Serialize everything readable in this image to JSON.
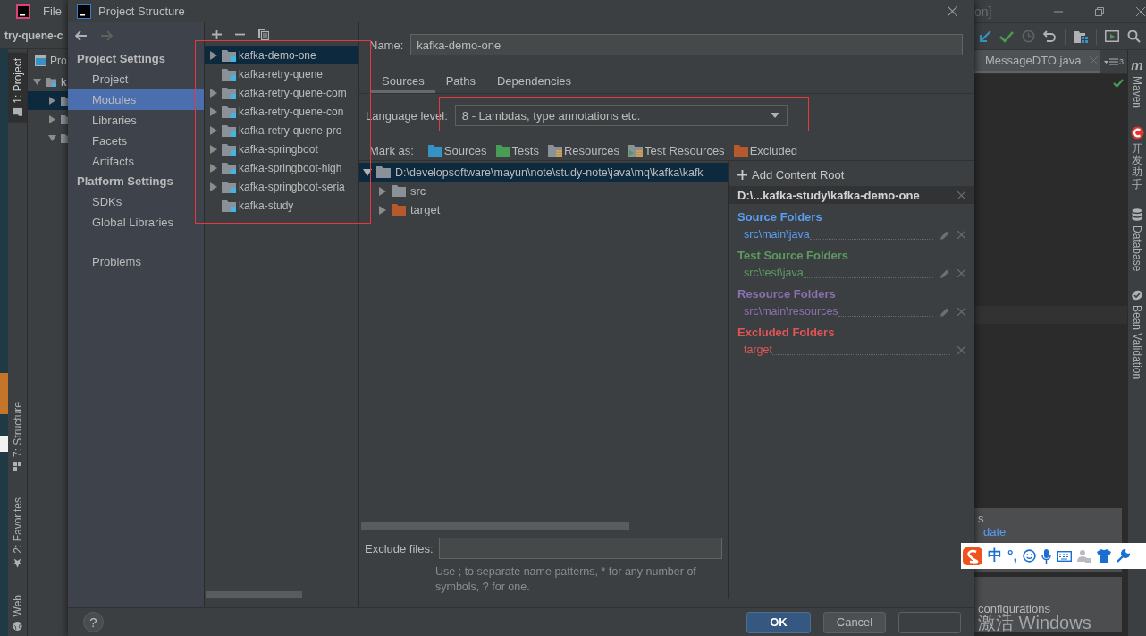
{
  "ide": {
    "menu": [
      "File"
    ],
    "project_name": "try-quene-c",
    "tool_tabs_left": [
      {
        "label": "1: Project",
        "kind": "project",
        "selected": true
      },
      {
        "label": "7: Structure",
        "kind": "structure",
        "selected": false
      },
      {
        "label": "2: Favorites",
        "kind": "favorites",
        "selected": false
      },
      {
        "label": "Web",
        "kind": "web",
        "selected": false
      }
    ],
    "project_panel": {
      "title": "Pro",
      "tree": [
        {
          "label": "k",
          "expanded": true,
          "selected": false,
          "children": [
            {
              "expanded": false,
              "selected": true
            },
            {
              "expanded": false,
              "selected": false
            },
            {
              "expanded": true,
              "selected": false
            }
          ]
        }
      ]
    },
    "window_title": "on]",
    "editor_tab": "MessageDTO.java",
    "tab_count": "3",
    "tool_tabs_right": [
      {
        "label": "Maven",
        "kind": "maven",
        "icon": "m"
      },
      {
        "label": "开发助手",
        "kind": "helper"
      },
      {
        "label": "Database",
        "kind": "database"
      },
      {
        "label": "Bean Validation",
        "kind": "bean"
      }
    ],
    "popups": [
      {
        "text": "s",
        "link": "date"
      },
      {
        "text": "configurations"
      }
    ],
    "ime": {
      "items": [
        "中",
        "°,"
      ]
    },
    "activation": "激活 Windows"
  },
  "dialog": {
    "title": "Project Structure",
    "nav": [
      {
        "heading": "Project Settings",
        "items": [
          {
            "label": "Project",
            "selected": false
          },
          {
            "label": "Modules",
            "selected": true
          },
          {
            "label": "Libraries",
            "selected": false
          },
          {
            "label": "Facets",
            "selected": false
          },
          {
            "label": "Artifacts",
            "selected": false
          }
        ]
      },
      {
        "heading": "Platform Settings",
        "items": [
          {
            "label": "SDKs",
            "selected": false
          },
          {
            "label": "Global Libraries",
            "selected": false
          }
        ]
      },
      {
        "items": [
          {
            "label": "Problems",
            "selected": false
          }
        ]
      }
    ],
    "modules": [
      {
        "name": "kafka-demo-one",
        "expandable": true,
        "selected": true
      },
      {
        "name": "kafka-retry-quene",
        "expandable": false,
        "selected": false
      },
      {
        "name": "kafka-retry-quene-com",
        "expandable": true,
        "selected": false
      },
      {
        "name": "kafka-retry-quene-con",
        "expandable": true,
        "selected": false
      },
      {
        "name": "kafka-retry-quene-pro",
        "expandable": true,
        "selected": false
      },
      {
        "name": "kafka-springboot",
        "expandable": true,
        "selected": false
      },
      {
        "name": "kafka-springboot-high",
        "expandable": true,
        "selected": false
      },
      {
        "name": "kafka-springboot-seria",
        "expandable": true,
        "selected": false
      },
      {
        "name": "kafka-study",
        "expandable": false,
        "selected": false
      }
    ],
    "name_label": "Name:",
    "name_value": "kafka-demo-one",
    "tabs": [
      {
        "label": "Sources",
        "selected": true
      },
      {
        "label": "Paths",
        "selected": false
      },
      {
        "label": "Dependencies",
        "selected": false
      }
    ],
    "language_level": {
      "label": "Language level:",
      "value": "8 - Lambdas, type annotations etc."
    },
    "mark_as": {
      "label": "Mark as:",
      "kinds": [
        {
          "label": "Sources",
          "kind": "sources"
        },
        {
          "label": "Tests",
          "kind": "tests"
        },
        {
          "label": "Resources",
          "kind": "resources"
        },
        {
          "label": "Test Resources",
          "kind": "test_resources"
        },
        {
          "label": "Excluded",
          "kind": "excluded"
        }
      ]
    },
    "content_tree": {
      "path": "D:\\developsoftware\\mayun\\note\\study-note\\java\\mq\\kafka\\kafk",
      "expanded": true,
      "selected": true,
      "children": [
        {
          "name": "src",
          "kind": "plain",
          "expanded": false
        },
        {
          "name": "target",
          "kind": "excluded",
          "expanded": false
        }
      ]
    },
    "add_content_root": "Add Content Root",
    "content_root": "D:\\...kafka-study\\kafka-demo-one",
    "folder_groups": [
      {
        "title": "Source Folders",
        "color": "#589df6",
        "folders": [
          {
            "path": "src\\main\\java",
            "editable": true
          }
        ]
      },
      {
        "title": "Test Source Folders",
        "color": "#5c9a5e",
        "folders": [
          {
            "path": "src\\test\\java",
            "editable": true
          }
        ]
      },
      {
        "title": "Resource Folders",
        "color": "#8b70b0",
        "folders": [
          {
            "path": "src\\main\\resources",
            "editable": true
          }
        ]
      },
      {
        "title": "Excluded Folders",
        "color": "#e05555",
        "folders": [
          {
            "path": "target",
            "editable": false
          }
        ]
      }
    ],
    "exclude_files": {
      "label": "Exclude files:",
      "hint": "Use ; to separate name patterns, * for any number of symbols, ? for one."
    },
    "help": "?",
    "buttons": [
      {
        "label": "OK",
        "kind": "default"
      },
      {
        "label": "Cancel",
        "kind": "normal"
      },
      {
        "kind": "disabled"
      }
    ]
  }
}
